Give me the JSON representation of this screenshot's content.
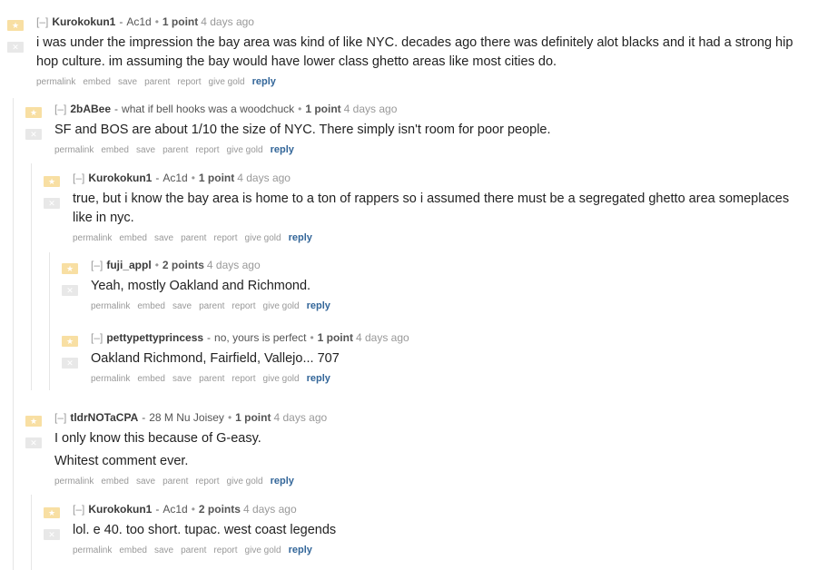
{
  "sep": "-",
  "dot": "•",
  "expand": "[–]",
  "vote_glyph": "★",
  "down_glyph": "✕",
  "buttons": [
    "permalink",
    "embed",
    "save",
    "parent",
    "report",
    "give gold",
    "reply"
  ],
  "comments": [
    {
      "author": "Kurokokun1",
      "flair": "Ac1d",
      "score": "1 point",
      "time": "4 days ago",
      "paragraphs": [
        "i was under the impression the bay area was kind of like NYC. decades ago there was definitely alot blacks and it had a strong hip hop culture. im assuming the bay would have lower class ghetto areas like most cities do."
      ]
    },
    {
      "author": "2bABee",
      "flair": "what if bell hooks was a woodchuck",
      "score": "1 point",
      "time": "4 days ago",
      "paragraphs": [
        "SF and BOS are about 1/10 the size of NYC. There simply isn't room for poor people."
      ]
    },
    {
      "author": "Kurokokun1",
      "flair": "Ac1d",
      "score": "1 point",
      "time": "4 days ago",
      "paragraphs": [
        "true, but i know the bay area is home to a ton of rappers so i assumed there must be a segregated ghetto area someplaces like in nyc."
      ]
    },
    {
      "author": "fuji_appl",
      "flair": "",
      "score": "2 points",
      "time": "4 days ago",
      "paragraphs": [
        "Yeah, mostly Oakland and Richmond."
      ]
    },
    {
      "author": "pettypettyprincess",
      "flair": "no, yours is perfect",
      "score": "1 point",
      "time": "4 days ago",
      "paragraphs": [
        "Oakland Richmond, Fairfield, Vallejo... 707"
      ]
    },
    {
      "author": "tldrNOTaCPA",
      "flair": "28 M Nu Joisey",
      "score": "1 point",
      "time": "4 days ago",
      "paragraphs": [
        "I only know this because of G-easy.",
        "Whitest comment ever."
      ]
    },
    {
      "author": "Kurokokun1",
      "flair": "Ac1d",
      "score": "2 points",
      "time": "4 days ago",
      "paragraphs": [
        "lol. e 40. too short. tupac. west coast legends"
      ]
    }
  ]
}
